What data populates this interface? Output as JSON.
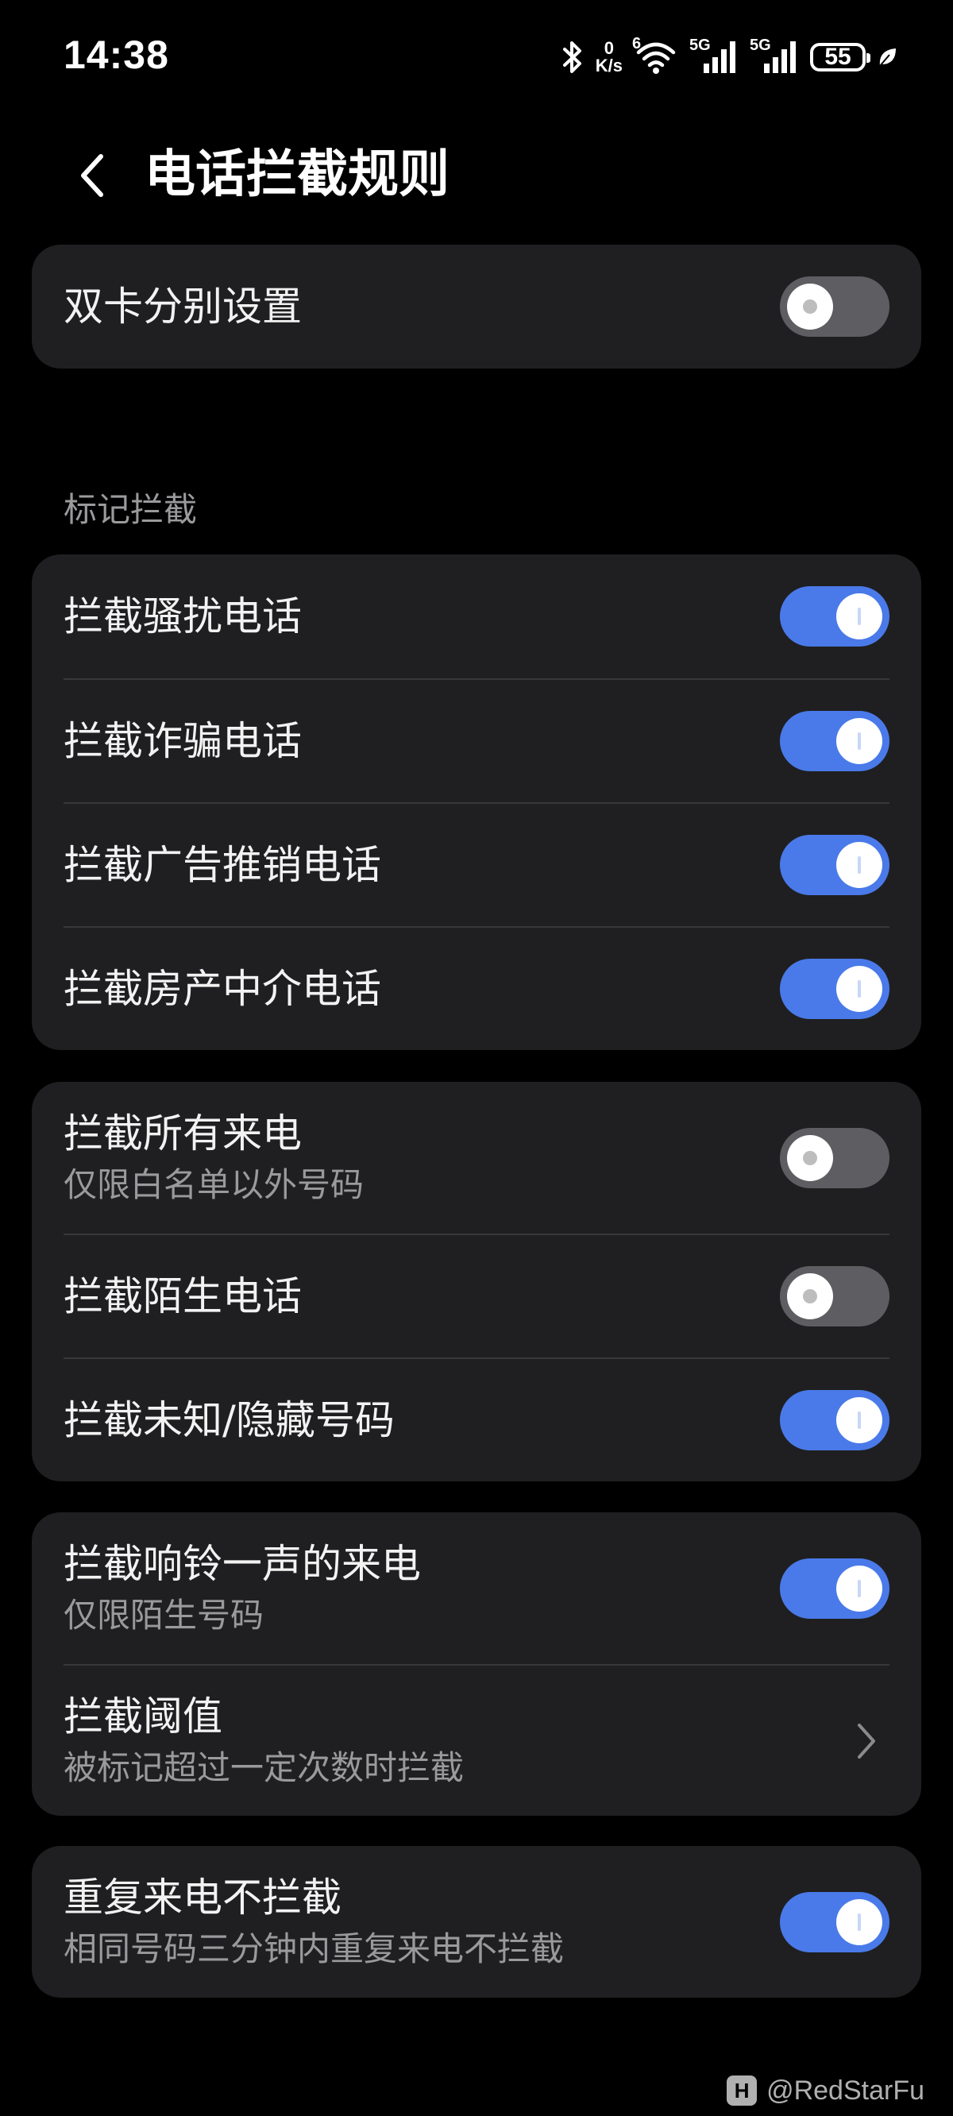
{
  "status_bar": {
    "time": "14:38",
    "net_speed_value": "0",
    "net_speed_unit": "K/s",
    "wifi_label": "6",
    "signal1_label": "5G",
    "signal2_label": "5G",
    "battery_level": "55",
    "icons": [
      "bluetooth-icon",
      "wifi-icon",
      "signal-icon",
      "signal-icon",
      "battery-icon",
      "leaf-icon"
    ]
  },
  "header": {
    "title": "电话拦截规则",
    "back_icon": "chevron-left-icon"
  },
  "dual_sim": {
    "label": "双卡分别设置",
    "enabled": false
  },
  "mark_section": {
    "label": "标记拦截",
    "items": [
      {
        "label": "拦截骚扰电话",
        "enabled": true
      },
      {
        "label": "拦截诈骗电话",
        "enabled": true
      },
      {
        "label": "拦截广告推销电话",
        "enabled": true
      },
      {
        "label": "拦截房产中介电话",
        "enabled": true
      }
    ]
  },
  "calls_section": {
    "items": [
      {
        "label": "拦截所有来电",
        "sub": "仅限白名单以外号码",
        "enabled": false
      },
      {
        "label": "拦截陌生电话",
        "enabled": false
      },
      {
        "label": "拦截未知/隐藏号码",
        "enabled": true
      }
    ]
  },
  "ring_section": {
    "one_ring": {
      "label": "拦截响铃一声的来电",
      "sub": "仅限陌生号码",
      "enabled": true
    },
    "threshold": {
      "label": "拦截阈值",
      "sub": "被标记超过一定次数时拦截",
      "icon": "chevron-right-icon"
    }
  },
  "repeat_section": {
    "label": "重复来电不拦截",
    "sub": "相同号码三分钟内重复来电不拦截",
    "enabled": true
  },
  "watermark": {
    "text": "@RedStarFu",
    "logo_letter": "H"
  },
  "colors": {
    "background": "#000000",
    "card": "#1f1f21",
    "toggle_on": "#4a7ae9",
    "toggle_off": "#5e5e62",
    "secondary_text": "#9a9a9d"
  }
}
